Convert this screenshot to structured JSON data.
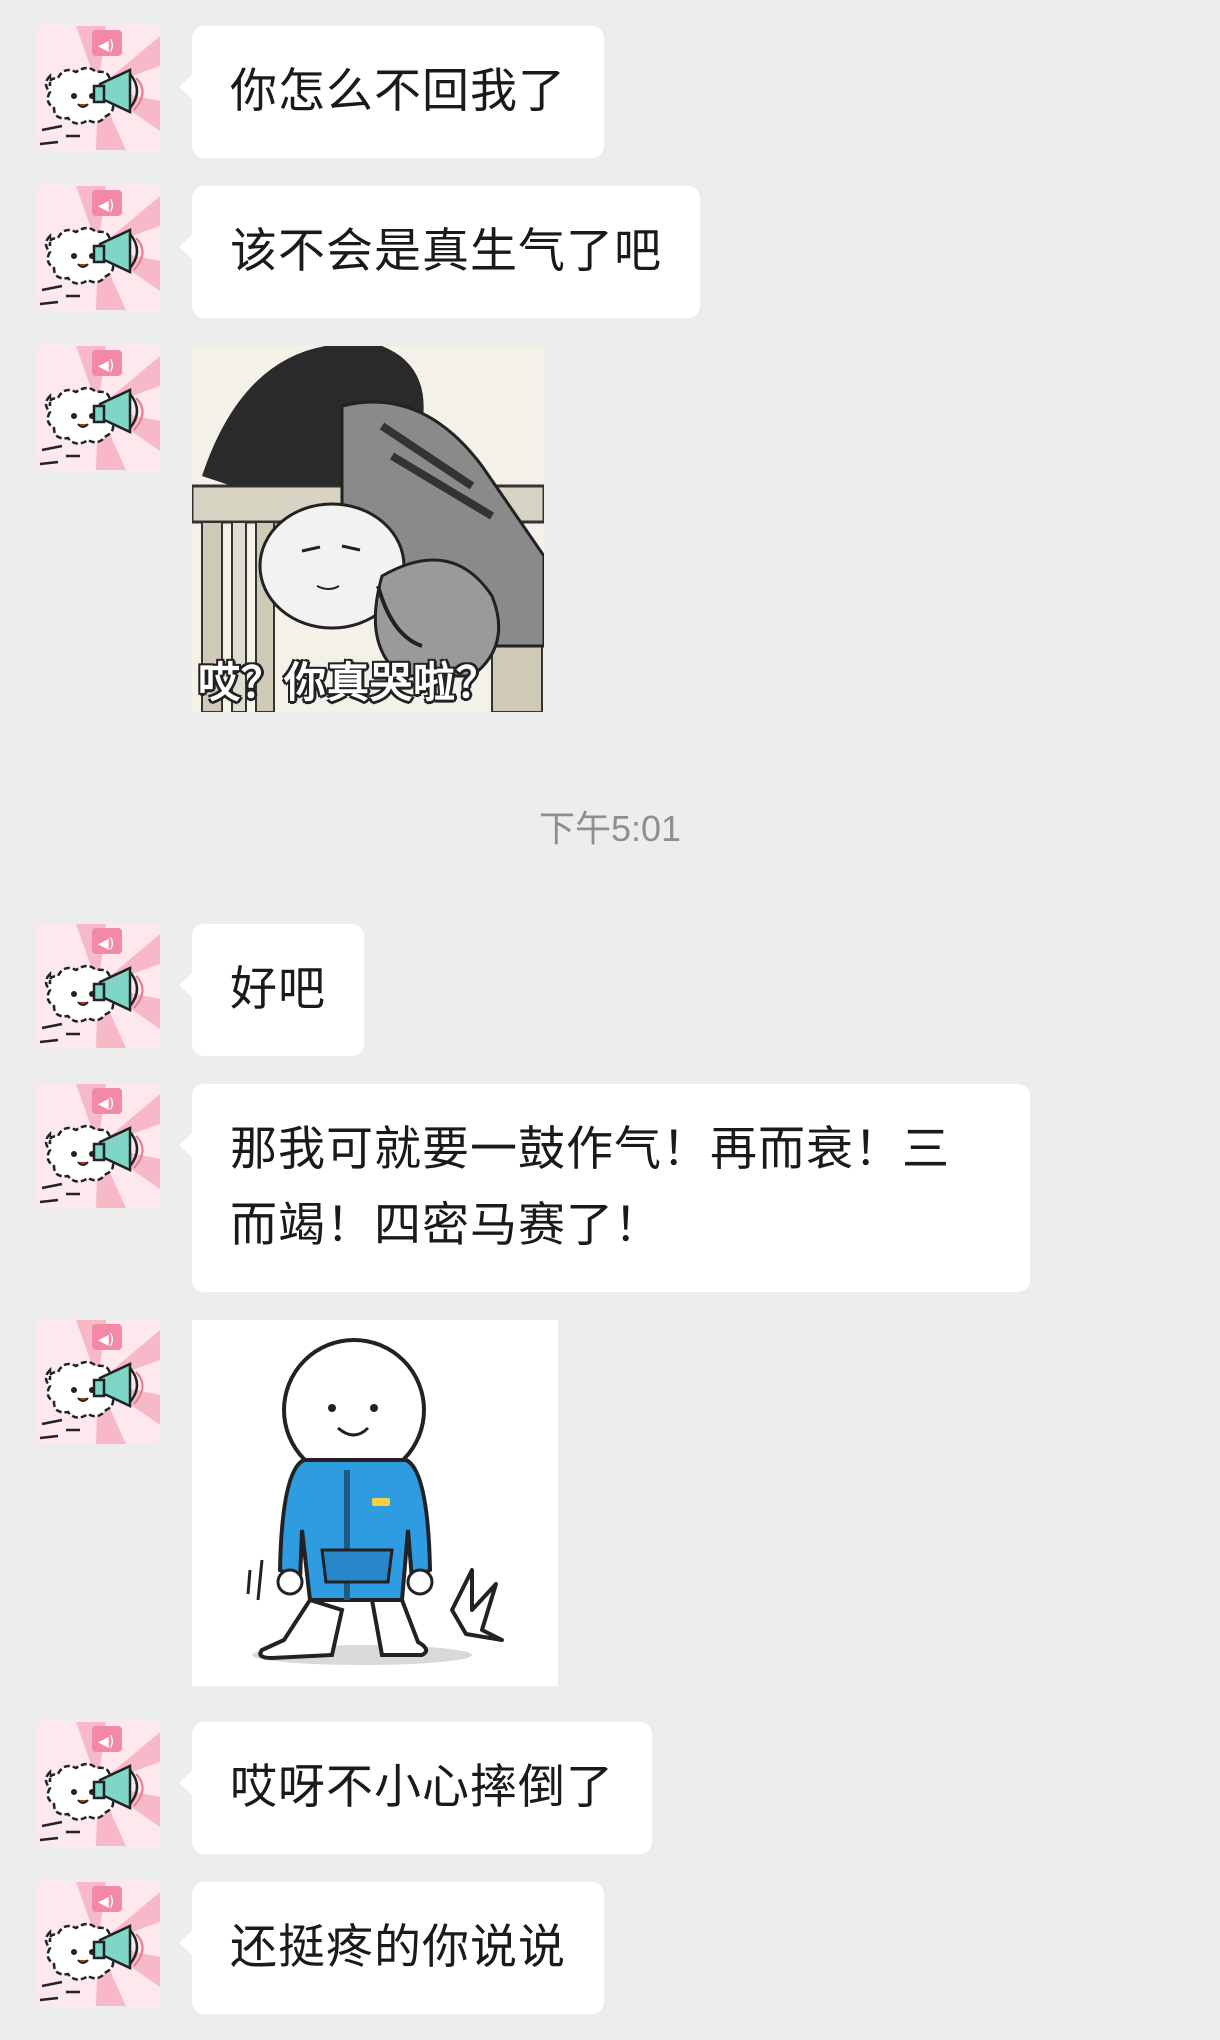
{
  "chat": {
    "messages": [
      {
        "type": "text",
        "text": "你怎么不回我了"
      },
      {
        "type": "text",
        "text": "该不会是真生气了吧"
      },
      {
        "type": "sticker",
        "icon": "crying-comic-sticker",
        "caption": "哎？你真哭啦？"
      },
      {
        "type": "timestamp",
        "text": "下午5:01"
      },
      {
        "type": "text",
        "text": "好吧"
      },
      {
        "type": "text",
        "text": "那我可就要一鼓作气！再而衰！三而竭！四密马赛了！"
      },
      {
        "type": "sticker",
        "icon": "kneeling-cartoon-sticker"
      },
      {
        "type": "text",
        "text": "哎呀不小心摔倒了"
      },
      {
        "type": "text",
        "text": "还挺疼的你说说"
      }
    ]
  },
  "avatar": {
    "icon": "sheep-megaphone-avatar"
  },
  "colors": {
    "background": "#ededed",
    "bubble": "#ffffff",
    "timestamp": "#8f8f8f",
    "hoodie": "#2f9be0"
  }
}
